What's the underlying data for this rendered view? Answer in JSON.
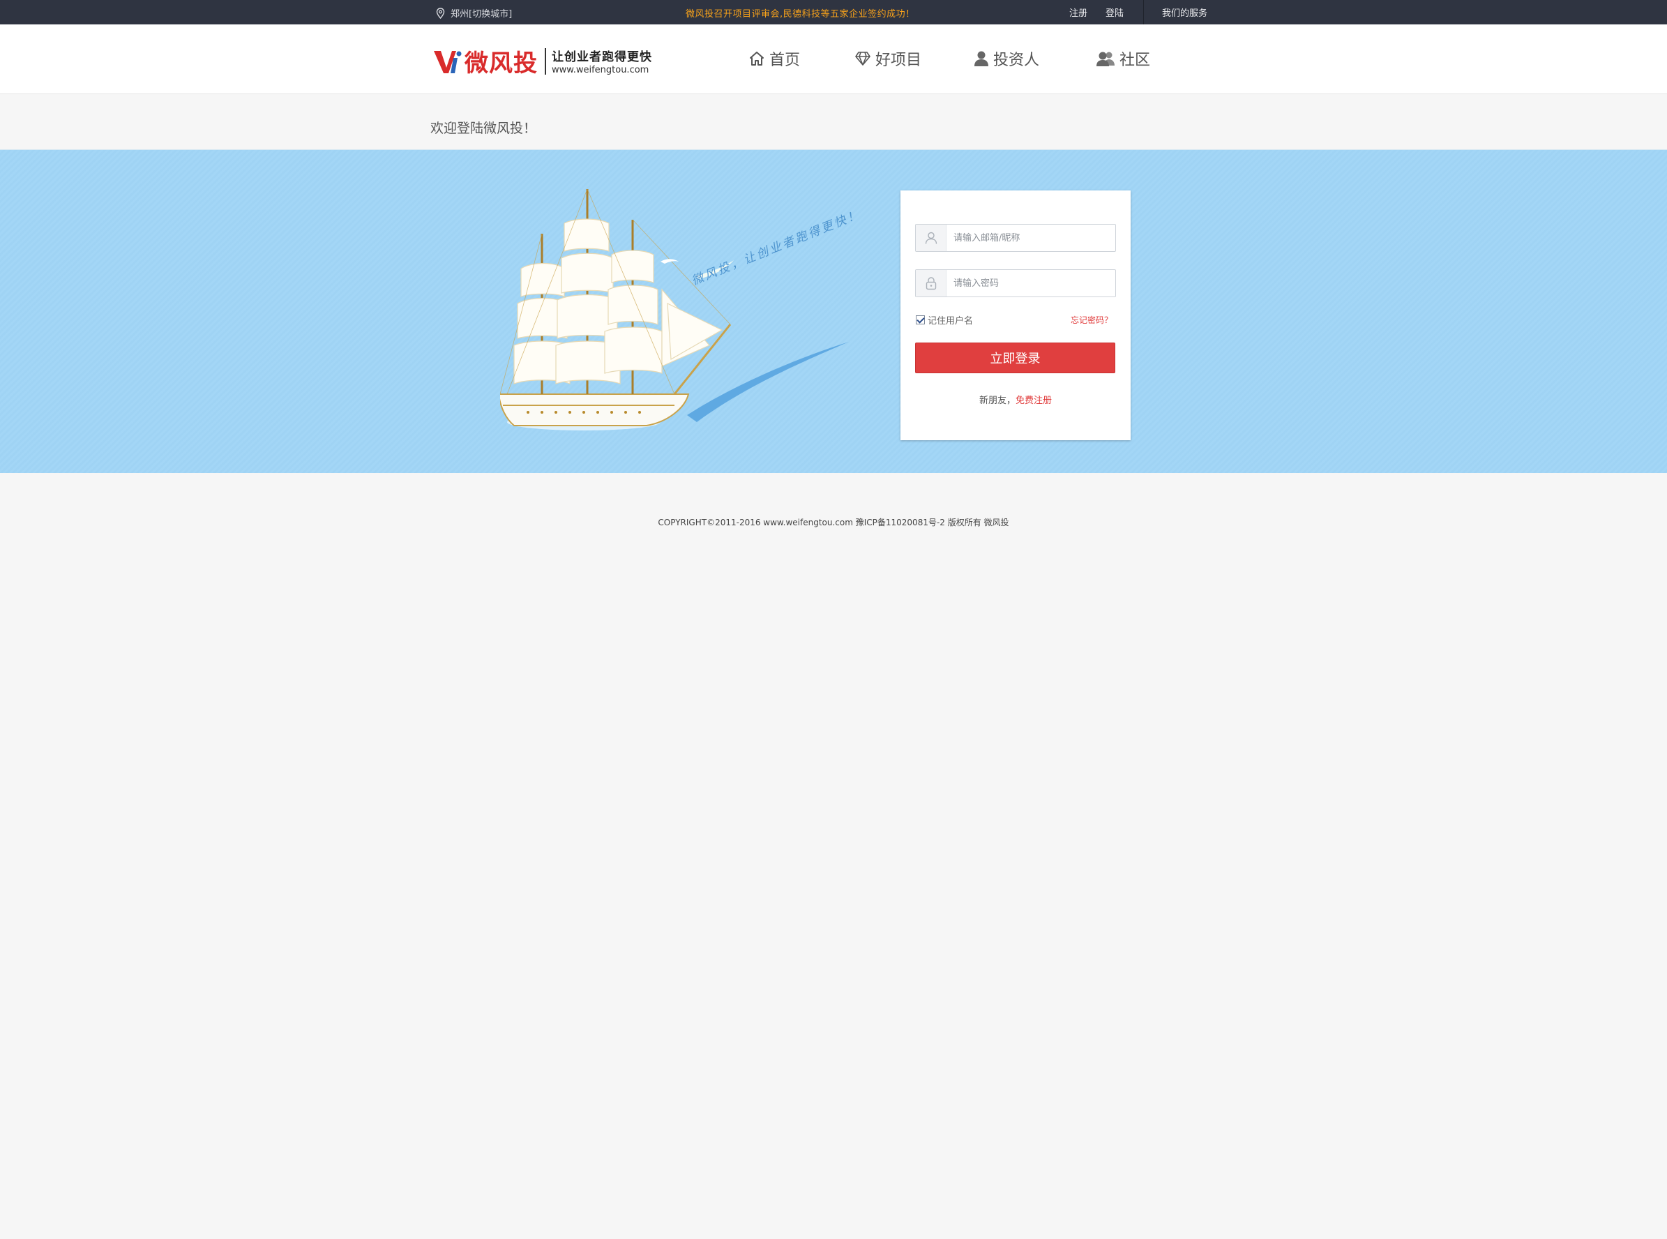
{
  "topbar": {
    "location": "郑州[切换城市]",
    "notice": "微风投召开项目评审会,民德科技等五家企业签约成功！",
    "register": "注册",
    "login": "登陆",
    "services": "我们的服务"
  },
  "header": {
    "brand": "微风投",
    "slogan": "让创业者跑得更快",
    "site": "www.weifengtou.com",
    "nav": [
      {
        "label": "首页",
        "icon": "home-icon"
      },
      {
        "label": "好项目",
        "icon": "diamond-icon"
      },
      {
        "label": "投资人",
        "icon": "person-icon"
      },
      {
        "label": "社区",
        "icon": "people-icon"
      }
    ]
  },
  "welcome": "欢迎登陆微风投！",
  "banner": {
    "slogan": "微风投，让创业者跑得更快！"
  },
  "login": {
    "email_placeholder": "请输入邮箱/昵称",
    "password_placeholder": "请输入密码",
    "remember": "记住用户名",
    "forgot": "忘记密码？",
    "submit": "立即登录",
    "newbie": "新朋友，",
    "free_register": "免费注册"
  },
  "footer": "COPYRIGHT©2011-2016 www.weifengtou.com 豫ICP备11020081号-2 版权所有 微风投",
  "colors": {
    "topbar": "#2f3441",
    "notice": "#f7a21b",
    "brand_red": "#d92b2b",
    "banner_blue": "#a3d6f6",
    "button_red": "#e03f3f"
  }
}
